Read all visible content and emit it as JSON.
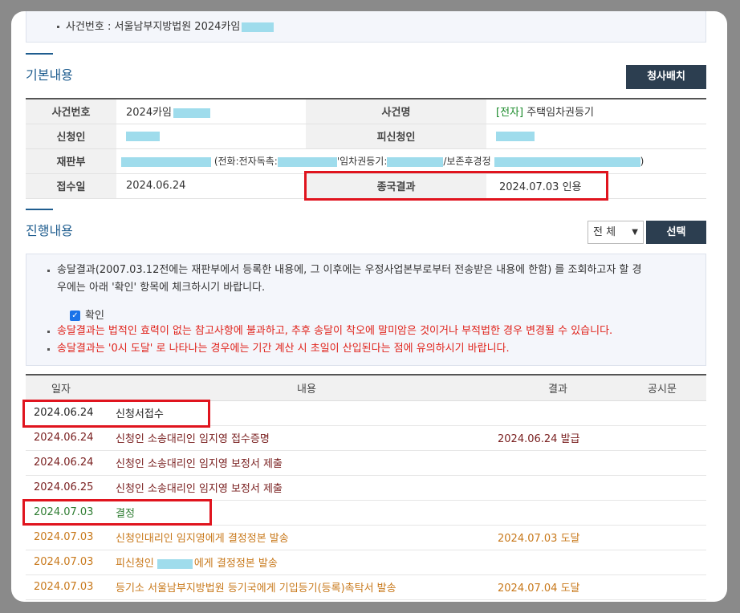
{
  "header": {
    "case_line": "사건번호 : 서울남부지방법원 2024카임"
  },
  "basic": {
    "title": "기본내용",
    "button": "청사배치",
    "rows": {
      "case_no_label": "사건번호",
      "case_no_value": "2024카임",
      "case_name_label": "사건명",
      "case_name_tag": "[전자]",
      "case_name_value": "주택임차권등기",
      "applicant_label": "신청인",
      "respondent_label": "피신청인",
      "court_label": "재판부",
      "court_phone": "(전화:전자독촉:",
      "court_lease": "'임차권등기:",
      "court_preserve": "/보존후경정",
      "court_end": ")",
      "received_label": "접수일",
      "received_value": "2024.06.24",
      "final_label": "종국결과",
      "final_value": "2024.07.03 인용"
    }
  },
  "progress": {
    "title": "진행내용",
    "filter_value": "전 체",
    "filter_button": "선택",
    "notice_1": "송달결과(2007.03.12전에는 재판부에서 등록한 내용에, 그 이후에는 우정사업본부로부터 전송받은 내용에 한함) 를 조회하고자 할 경",
    "notice_1b": "우에는 아래 '확인' 항목에 체크하시기 바랍니다.",
    "confirm_label": "확인",
    "notice_2": "송달결과는 법적인 효력이 없는 참고사항에 불과하고, 추후 송달이 착오에 말미암은 것이거나 부적법한 경우 변경될 수 있습니다.",
    "notice_3": "송달결과는 '0시 도달' 로 나타나는 경우에는 기간 계산 시 초일이 산입된다는 점에 유의하시기 바랍니다.",
    "columns": [
      "일자",
      "내용",
      "결과",
      "공시문"
    ],
    "rows": [
      {
        "date": "2024.06.24",
        "content": "신청서접수",
        "result": "",
        "style": "black"
      },
      {
        "date": "2024.06.24",
        "content": "신청인 소송대리인 임지영 접수증명",
        "result": "2024.06.24 발급",
        "style": "maroon"
      },
      {
        "date": "2024.06.24",
        "content": "신청인 소송대리인 임지영 보정서 제출",
        "result": "",
        "style": "maroon"
      },
      {
        "date": "2024.06.25",
        "content": "신청인 소송대리인 임지영 보정서 제출",
        "result": "",
        "style": "maroon"
      },
      {
        "date": "2024.07.03",
        "content": "결정",
        "result": "",
        "style": "green"
      },
      {
        "date": "2024.07.03",
        "content": "신청인대리인 임지영에게 결정정본 발송",
        "result": "2024.07.03 도달",
        "style": "orange"
      },
      {
        "date": "2024.07.03",
        "content": "피신청인",
        "content_after": "에게 결정정본 발송",
        "redacted": true,
        "result": "",
        "style": "orange"
      },
      {
        "date": "2024.07.03",
        "content": "등기소 서울남부지방법원 등기국에게 기입등기(등록)촉탁서 발송",
        "result": "2024.07.04 도달",
        "style": "orange"
      }
    ]
  },
  "colors": {
    "accent_blue": "#1f5d8f",
    "dark_button": "#2c3e50",
    "highlight_red": "#e0141e",
    "redaction": "#9fdcec"
  }
}
